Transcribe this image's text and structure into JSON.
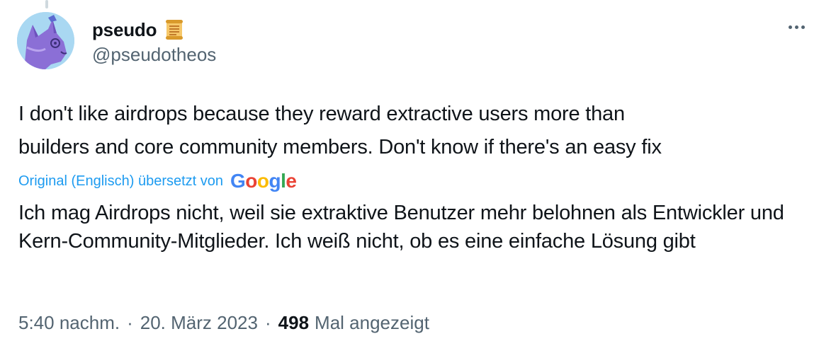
{
  "author": {
    "display_name": "pseudo",
    "handle": "@pseudotheos",
    "avatar_icon": "purple-cat-avatar",
    "badge_icon": "scroll-icon"
  },
  "menu": {
    "more_icon": "more-horizontal-icon"
  },
  "tweet": {
    "text": "I don't like airdrops because they reward extractive users more than\nbuilders and core community members. Don't know if there's an easy fix"
  },
  "translation": {
    "credit_label": "Original (Englisch) übersetzt von",
    "provider_logo": "Google",
    "text": "Ich mag Airdrops nicht, weil sie extraktive Benutzer mehr belohnen als Entwickler und Kern-Community-Mitglieder. Ich weiß nicht, ob es eine einfache Lösung gibt"
  },
  "meta": {
    "time": "5:40 nachm.",
    "separator": "·",
    "date": "20. März 2023",
    "views_count": "498",
    "views_label": "Mal angezeigt"
  },
  "colors": {
    "text": "#0f1419",
    "secondary": "#536471",
    "link": "#1d9bf0"
  }
}
